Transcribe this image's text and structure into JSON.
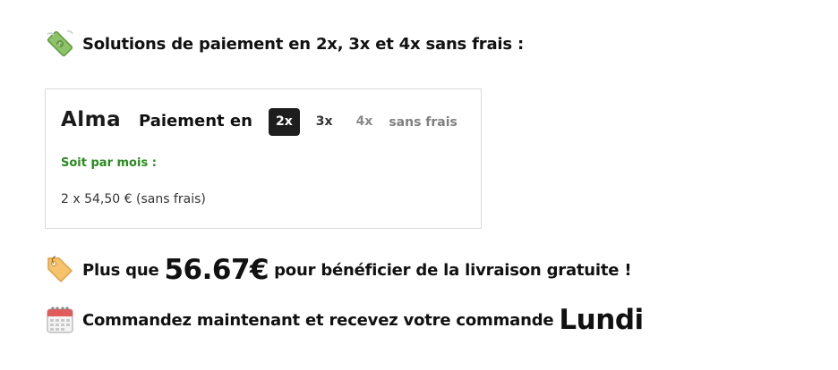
{
  "payment_heading": {
    "icon": "money-with-wings-icon",
    "text": "Solutions de paiement en 2x, 3x et 4x sans frais :"
  },
  "alma": {
    "logo": "Alma",
    "label": "Paiement en",
    "options": [
      "2x",
      "3x",
      "4x"
    ],
    "selected_option": "2x",
    "disabled_option": "4x",
    "no_fees_note": "sans frais",
    "monthly_label": "Soit par mois :",
    "monthly_detail": "2 x 54,50 € (sans frais)",
    "colors": {
      "active_bg": "#1e1e1e",
      "monthly_label": "#2a8a1f"
    }
  },
  "shipping": {
    "icon": "label-tag-icon",
    "prefix": "Plus que",
    "amount": "56.67€",
    "suffix": "pour bénéficier de la livraison gratuite !"
  },
  "delivery": {
    "icon": "calendar-icon",
    "text": "Commandez maintenant et recevez votre commande",
    "day": "Lundi"
  }
}
